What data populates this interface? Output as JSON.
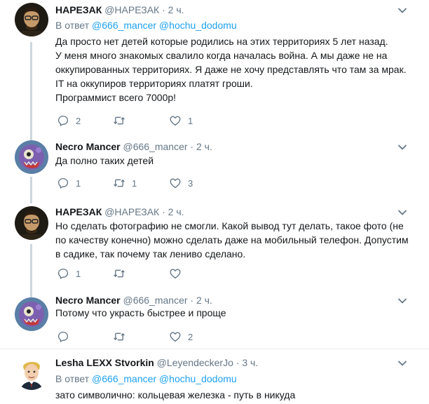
{
  "tweets": [
    {
      "name": "НАРЕЗАК",
      "handle": "@НАРЕЗАК",
      "dot": "·",
      "time": "2 ч.",
      "reply_prefix": "В ответ",
      "reply_mentions": "@666_mancer @hochu_dodomu",
      "lines": [
        "Да просто нет детей которые родились на этих территориях 5 лет назад.",
        "У меня много знакомых свалило когда началась война. А мы даже не на",
        "оккупированных территориях. Я даже не хочу представлять что там за мрак.",
        "IT на оккупиров территориях платят гроши.",
        "Программист всего 7000р!"
      ],
      "replies": "2",
      "retweets": "",
      "likes": "1"
    },
    {
      "name": "Necro Mancer",
      "handle": "@666_mancer",
      "dot": "·",
      "time": "2 ч.",
      "lines": [
        "Да полно таких детей"
      ],
      "replies": "1",
      "retweets": "1",
      "likes": "3"
    },
    {
      "name": "НАРЕЗАК",
      "handle": "@НАРЕЗАК",
      "dot": "·",
      "time": "2 ч.",
      "lines": [
        "Но сделать фотографию не смогли. Какой вывод тут делать, такое фото (не",
        "по качеству конечно) можно сделать даже на мобильный телефон. Допустим",
        "в садике, так почему так лениво сделано."
      ],
      "replies": "1",
      "retweets": "",
      "likes": ""
    },
    {
      "name": "Necro Mancer",
      "handle": "@666_mancer",
      "dot": "·",
      "time": "2 ч.",
      "lines": [
        "Потому что украсть быстрее и проще"
      ],
      "replies": "",
      "retweets": "",
      "likes": "2"
    },
    {
      "name": "Lesha LEXX Stvorkin",
      "handle": "@LeyendeckerJo",
      "dot": "·",
      "time": "3 ч.",
      "reply_prefix": "В ответ",
      "reply_mentions": "@666_mancer @hochu_dodomu",
      "lines": [
        "зато символично: кольцевая железка - путь в никуда"
      ]
    }
  ],
  "icons": {
    "reply": "reply-icon",
    "retweet": "retweet-icon",
    "like": "heart-icon",
    "menu": "chevron-down-icon"
  },
  "colors": {
    "name": "#14171a",
    "secondary": "#657786",
    "mention": "#1da1f2",
    "thread_line": "#ccd6dd",
    "separator": "#e6ecf0"
  }
}
